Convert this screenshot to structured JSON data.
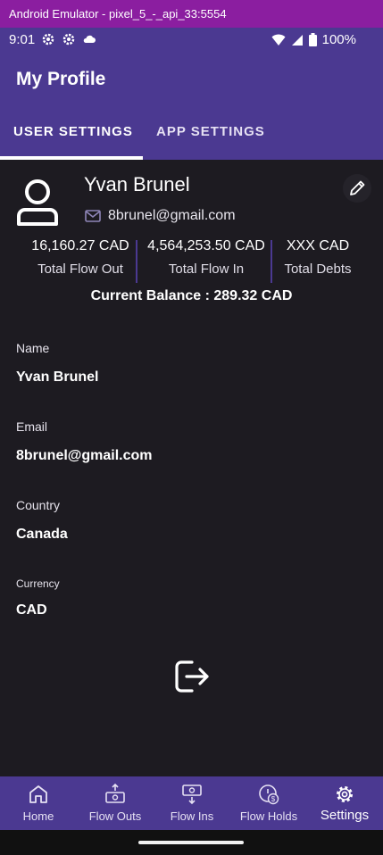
{
  "emulator": {
    "title": "Android Emulator - pixel_5_-_api_33:5554"
  },
  "status": {
    "time": "9:01",
    "battery": "100%"
  },
  "appbar": {
    "title": "My Profile"
  },
  "tabs": [
    {
      "label": "USER SETTINGS",
      "active": true
    },
    {
      "label": "APP SETTINGS",
      "active": false
    }
  ],
  "profile": {
    "name": "Yvan Brunel",
    "email": "8brunel@gmail.com",
    "stats": [
      {
        "value": "16,160.27 CAD",
        "label": "Total Flow Out"
      },
      {
        "value": "4,564,253.50 CAD",
        "label": "Total Flow In"
      },
      {
        "value": "XXX CAD",
        "label": "Total Debts"
      }
    ],
    "balance": "Current Balance : 289.32 CAD"
  },
  "fields": [
    {
      "label": "Name",
      "value": "Yvan Brunel"
    },
    {
      "label": "Email",
      "value": "8brunel@gmail.com"
    },
    {
      "label": "Country",
      "value": "Canada"
    },
    {
      "label": "Currency",
      "value": "CAD"
    }
  ],
  "nav": [
    {
      "label": "Home",
      "icon": "home-icon"
    },
    {
      "label": "Flow Outs",
      "icon": "flow-outs-icon"
    },
    {
      "label": "Flow Ins",
      "icon": "flow-ins-icon"
    },
    {
      "label": "Flow Holds",
      "icon": "flow-holds-icon"
    },
    {
      "label": "Settings",
      "icon": "gear-icon",
      "active": true
    }
  ],
  "colors": {
    "primary": "#4b3991",
    "background": "#1d1b21",
    "emulator_bar": "#8b1ea0"
  }
}
